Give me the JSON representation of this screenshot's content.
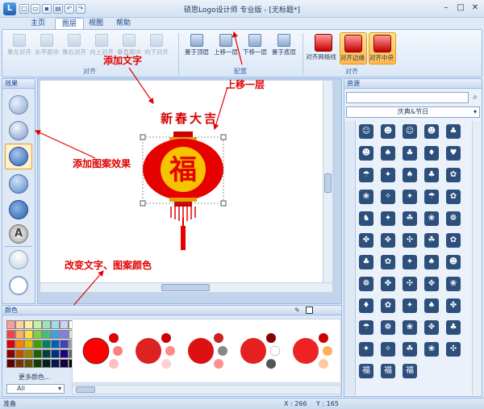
{
  "window": {
    "title": "硕思Logo设计师 专业版 - [无标题*]"
  },
  "tabs": [
    "主页",
    "图层",
    "视图",
    "帮助"
  ],
  "ribbon": {
    "align_group": {
      "label": "对齐",
      "buttons": [
        "靠左对齐",
        "水平居中",
        "靠右对齐",
        "向上对齐",
        "垂直居中",
        "向下对齐"
      ]
    },
    "arrange_group": {
      "label": "配置",
      "buttons": [
        "置于顶层",
        "上移一层",
        "下移一层",
        "置于底层"
      ]
    },
    "snap_group": {
      "label": "对齐",
      "buttons": [
        "对齐网格线",
        "对齐边缘",
        "对齐中央"
      ]
    }
  },
  "effects_panel": {
    "title": "效果"
  },
  "resources_panel": {
    "title": "资源",
    "category": "庆典&节日",
    "last_row_chars": [
      "福",
      "福",
      "福"
    ]
  },
  "colors_panel": {
    "title": "颜色",
    "more_colors": "更多颜色...",
    "filter": "All",
    "palette": [
      "#ff9a9a",
      "#ffd0a0",
      "#fff0a0",
      "#c8f0a0",
      "#a0e0c0",
      "#a0d8f0",
      "#d0d0f0",
      "#ffffff",
      "#ff4040",
      "#ffb060",
      "#ffe040",
      "#80d040",
      "#40c080",
      "#40a0e0",
      "#8080e0",
      "#e0e0e0",
      "#e00000",
      "#ff8000",
      "#e0c000",
      "#40a000",
      "#008060",
      "#0060c0",
      "#4040c0",
      "#a0a0a0",
      "#900000",
      "#c05000",
      "#a08000",
      "#206000",
      "#004040",
      "#003080",
      "#200080",
      "#606060",
      "#600000",
      "#803000",
      "#605000",
      "#104000",
      "#002020",
      "#001850",
      "#100040",
      "#000000"
    ]
  },
  "canvas": {
    "text": "新春大吉",
    "lantern_char": "福"
  },
  "annotations": {
    "add_text": "添加文字",
    "move_up": "上移一层",
    "add_effect": "添加图案效果",
    "change_color": "改变文字、图案颜色"
  },
  "status": {
    "ready": "准备",
    "x": "X : 266",
    "y": "Y : 165"
  }
}
